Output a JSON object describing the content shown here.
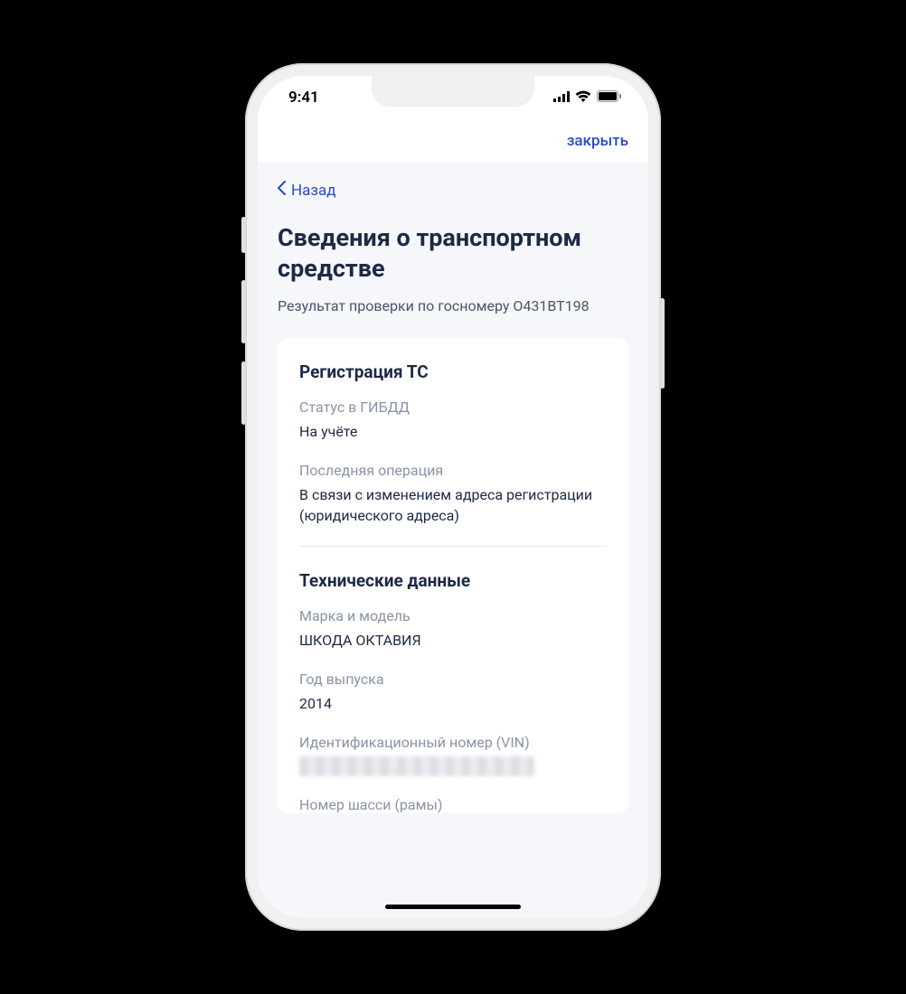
{
  "statusBar": {
    "time": "9:41"
  },
  "nav": {
    "close": "закрыть"
  },
  "back": {
    "label": "Назад"
  },
  "header": {
    "title": "Сведения о транспортном средстве",
    "subtitle": "Результат проверки по госномеру О431ВТ198"
  },
  "sections": {
    "registration": {
      "title": "Регистрация ТС",
      "statusLabel": "Статус в ГИБДД",
      "statusValue": "На учёте",
      "lastOpLabel": "Последняя операция",
      "lastOpValue": "В связи с изменением адреса регистрации (юридического адреса)"
    },
    "technical": {
      "title": "Технические данные",
      "makeLabel": "Марка и модель",
      "makeValue": "ШКОДА ОКТАВИЯ",
      "yearLabel": "Год выпуска",
      "yearValue": "2014",
      "vinLabel": "Идентификационный номер (VIN)",
      "chassisLabel": "Номер шасси (рамы)"
    }
  }
}
